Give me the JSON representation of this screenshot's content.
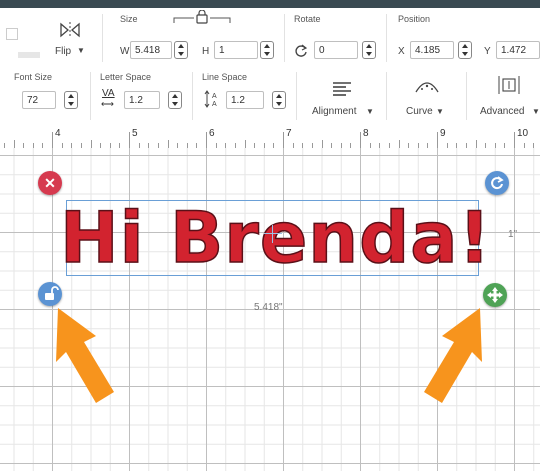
{
  "toolbar": {
    "flip_label": "Flip",
    "size": {
      "label": "Size",
      "w_label": "W",
      "w_value": "5.418",
      "h_label": "H",
      "h_value": "1"
    },
    "rotate": {
      "label": "Rotate",
      "value": "0"
    },
    "position": {
      "label": "Position",
      "x_label": "X",
      "x_value": "4.185",
      "y_label": "Y",
      "y_value": "1.472"
    },
    "font_size": {
      "label": "Font Size",
      "value": "72"
    },
    "letter_space": {
      "label": "Letter Space",
      "icon_text": "VA",
      "value": "1.2"
    },
    "line_space": {
      "label": "Line Space",
      "value": "1.2"
    },
    "alignment_label": "Alignment",
    "curve_label": "Curve",
    "advanced_label": "Advanced"
  },
  "ruler": {
    "labels": [
      "4",
      "5",
      "6",
      "7",
      "8",
      "9",
      "10"
    ]
  },
  "canvas": {
    "text": "Hi Brenda!",
    "width_dim": "5.418\"",
    "height_dim": "1\"",
    "colors": {
      "text_fill": "#d2232f",
      "delete": "#d63a4f",
      "rotate": "#5b93d3",
      "lock": "#5b93d3",
      "resize": "#4fa356",
      "arrow": "#f7941d"
    }
  }
}
